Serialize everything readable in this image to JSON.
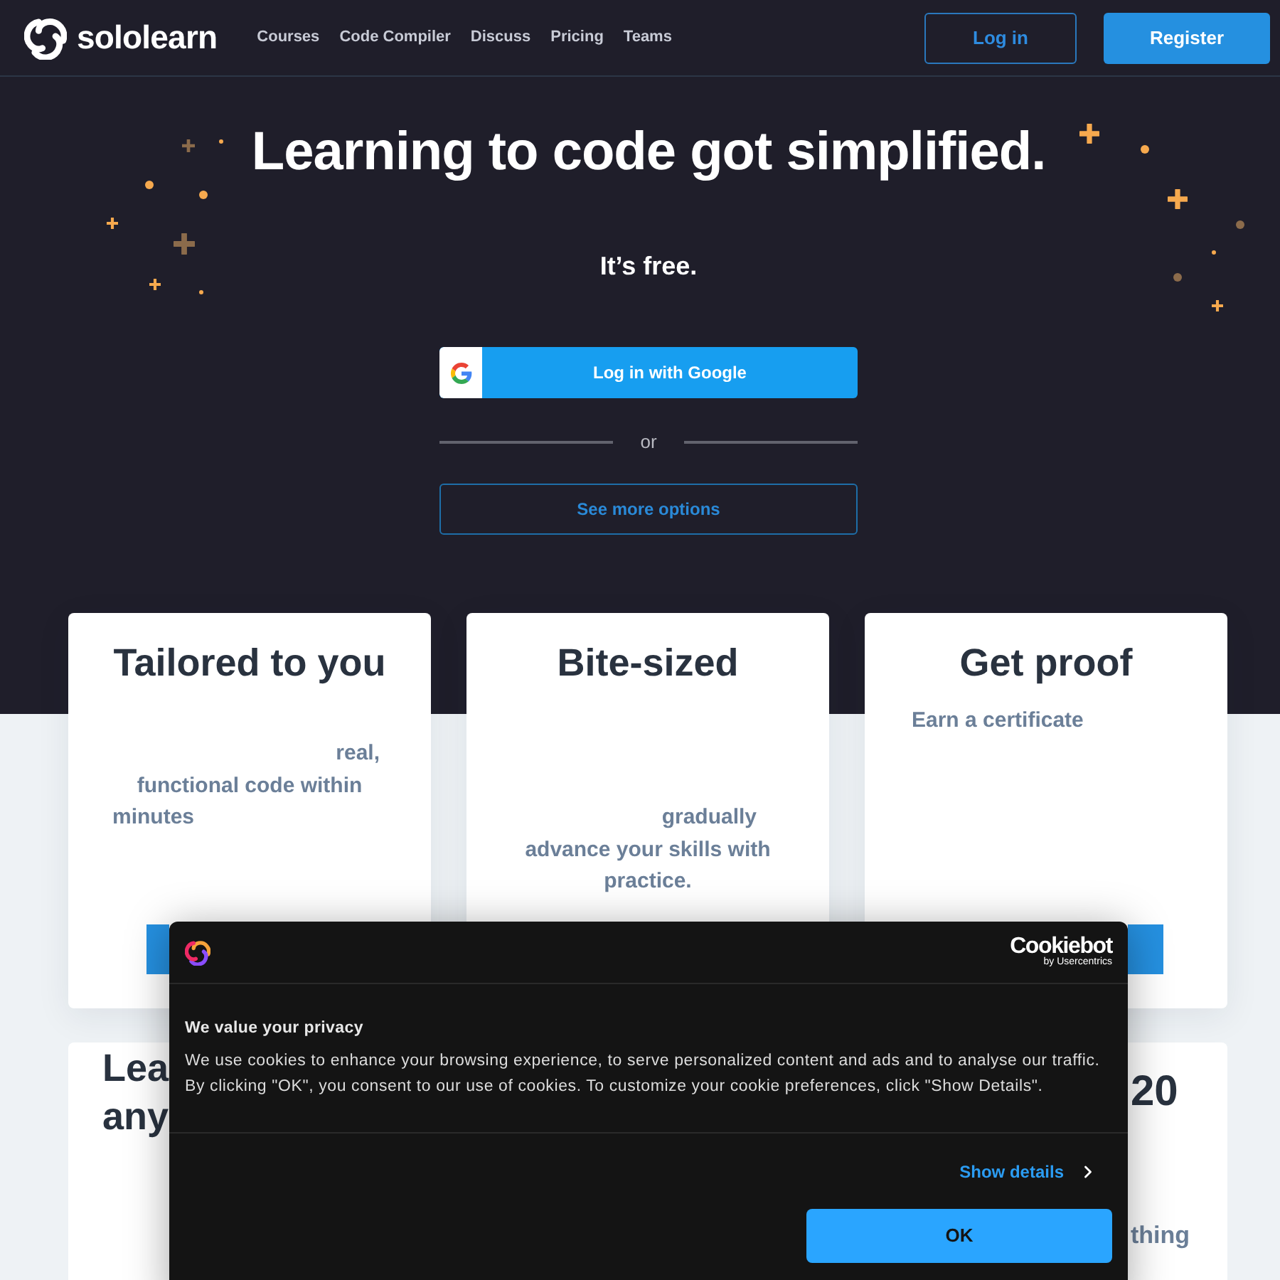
{
  "header": {
    "logo_text": "sololearn",
    "nav": [
      "Courses",
      "Code Compiler",
      "Discuss",
      "Pricing",
      "Teams"
    ],
    "login_button": "Log in",
    "register_button": "Register"
  },
  "hero": {
    "title": "Learning to code got simplified.",
    "subtitle": "It’s free.",
    "google_button": "Log in with Google",
    "divider_text": "or",
    "more_options_button": "See more options"
  },
  "feature_cards": [
    {
      "title": "Tailored to you",
      "lines": [
        "real,",
        "functional code within",
        "minutes"
      ]
    },
    {
      "title": "Bite-sized",
      "lines": [
        "gradually",
        "advance your skills with",
        "practice."
      ]
    },
    {
      "title": "Get proof",
      "lines": [
        "Earn a certificate"
      ]
    }
  ],
  "lower_card": {
    "heading_lines": [
      "Lea",
      "any"
    ],
    "right_heading": "20",
    "right_text": "thing"
  },
  "cookie_dialog": {
    "brand": "Cookiebot",
    "brand_sub": "by Usercentrics",
    "title": "We value your privacy",
    "body": "We use cookies to enhance your browsing experience, to serve personalized content and ads and to analyse our traffic. By clicking \"OK\", you consent to our use of cookies. To customize your cookie preferences, click \"Show Details\".",
    "details_link": "Show details",
    "ok_button": "OK"
  }
}
